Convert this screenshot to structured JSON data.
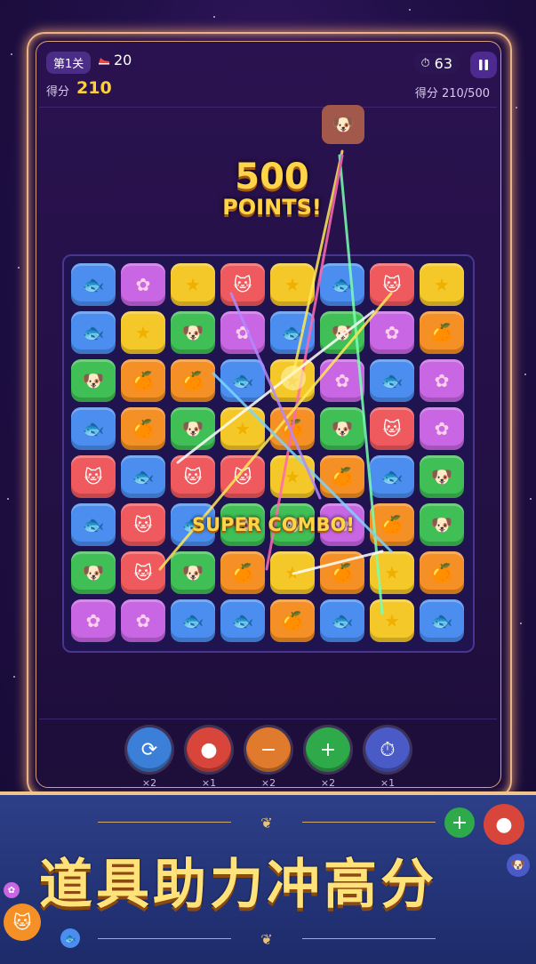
{
  "hud": {
    "level": "第1关",
    "moves": "20",
    "score_label": "得分",
    "score": "210",
    "timer": "63",
    "goal": "得分 210/500"
  },
  "effects": {
    "points_big": "500",
    "points_small": "POINTS!",
    "combo": "SUPER COMBO!"
  },
  "board": {
    "rows": [
      [
        [
          "blue",
          "fish"
        ],
        [
          "purple",
          "flower"
        ],
        [
          "yellow",
          "star"
        ],
        [
          "red",
          "cat"
        ],
        [
          "yellow",
          "star"
        ],
        [
          "blue",
          "fish"
        ],
        [
          "red",
          "cat"
        ],
        [
          "yellow",
          "star"
        ]
      ],
      [
        [
          "blue",
          "fish"
        ],
        [
          "yellow",
          "star"
        ],
        [
          "green",
          "dog"
        ],
        [
          "purple",
          "flower"
        ],
        [
          "blue",
          "fish"
        ],
        [
          "green",
          "dog"
        ],
        [
          "purple",
          "flower"
        ],
        [
          "orange",
          "orange"
        ]
      ],
      [
        [
          "green",
          "dog"
        ],
        [
          "orange",
          "orange"
        ],
        [
          "orange",
          "orange"
        ],
        [
          "blue",
          "fish"
        ],
        [
          "yellow",
          "star"
        ],
        [
          "purple",
          "flower"
        ],
        [
          "blue",
          "fish"
        ],
        [
          "purple",
          "flower"
        ]
      ],
      [
        [
          "blue",
          "fish"
        ],
        [
          "orange",
          "orange"
        ],
        [
          "green",
          "dog"
        ],
        [
          "yellow",
          "star"
        ],
        [
          "orange",
          "orange"
        ],
        [
          "green",
          "dog"
        ],
        [
          "red",
          "cat"
        ],
        [
          "purple",
          "flower"
        ]
      ],
      [
        [
          "red",
          "cat"
        ],
        [
          "blue",
          "fish"
        ],
        [
          "red",
          "cat"
        ],
        [
          "red",
          "cat"
        ],
        [
          "yellow",
          "star"
        ],
        [
          "orange",
          "orange"
        ],
        [
          "blue",
          "fish"
        ],
        [
          "green",
          "dog"
        ]
      ],
      [
        [
          "blue",
          "fish"
        ],
        [
          "red",
          "cat"
        ],
        [
          "blue",
          "fish"
        ],
        [
          "green",
          "dog"
        ],
        [
          "green",
          "dog"
        ],
        [
          "purple",
          "flower"
        ],
        [
          "orange",
          "orange"
        ],
        [
          "green",
          "dog"
        ]
      ],
      [
        [
          "green",
          "dog"
        ],
        [
          "red",
          "cat"
        ],
        [
          "green",
          "dog"
        ],
        [
          "orange",
          "orange"
        ],
        [
          "yellow",
          "star"
        ],
        [
          "orange",
          "orange"
        ],
        [
          "yellow",
          "star"
        ],
        [
          "orange",
          "orange"
        ]
      ],
      [
        [
          "purple",
          "flower"
        ],
        [
          "purple",
          "flower"
        ],
        [
          "blue",
          "fish"
        ],
        [
          "blue",
          "fish"
        ],
        [
          "orange",
          "orange"
        ],
        [
          "blue",
          "fish"
        ],
        [
          "yellow",
          "star"
        ],
        [
          "blue",
          "fish"
        ]
      ]
    ]
  },
  "tools": [
    {
      "name": "shuffle-icon",
      "glyph": "⟳",
      "color": "#3b7fd8",
      "count": "×2"
    },
    {
      "name": "bomb-icon",
      "glyph": "●",
      "color": "#d8453b",
      "count": "×1"
    },
    {
      "name": "minus-icon",
      "glyph": "−",
      "color": "#e07a2c",
      "count": "×2"
    },
    {
      "name": "plus-icon",
      "glyph": "+",
      "color": "#2faa4a",
      "count": "×2"
    },
    {
      "name": "stopwatch-icon",
      "glyph": "⏱",
      "color": "#4a5bc8",
      "count": "×1"
    }
  ],
  "banner": {
    "title": "道具助力冲高分"
  }
}
